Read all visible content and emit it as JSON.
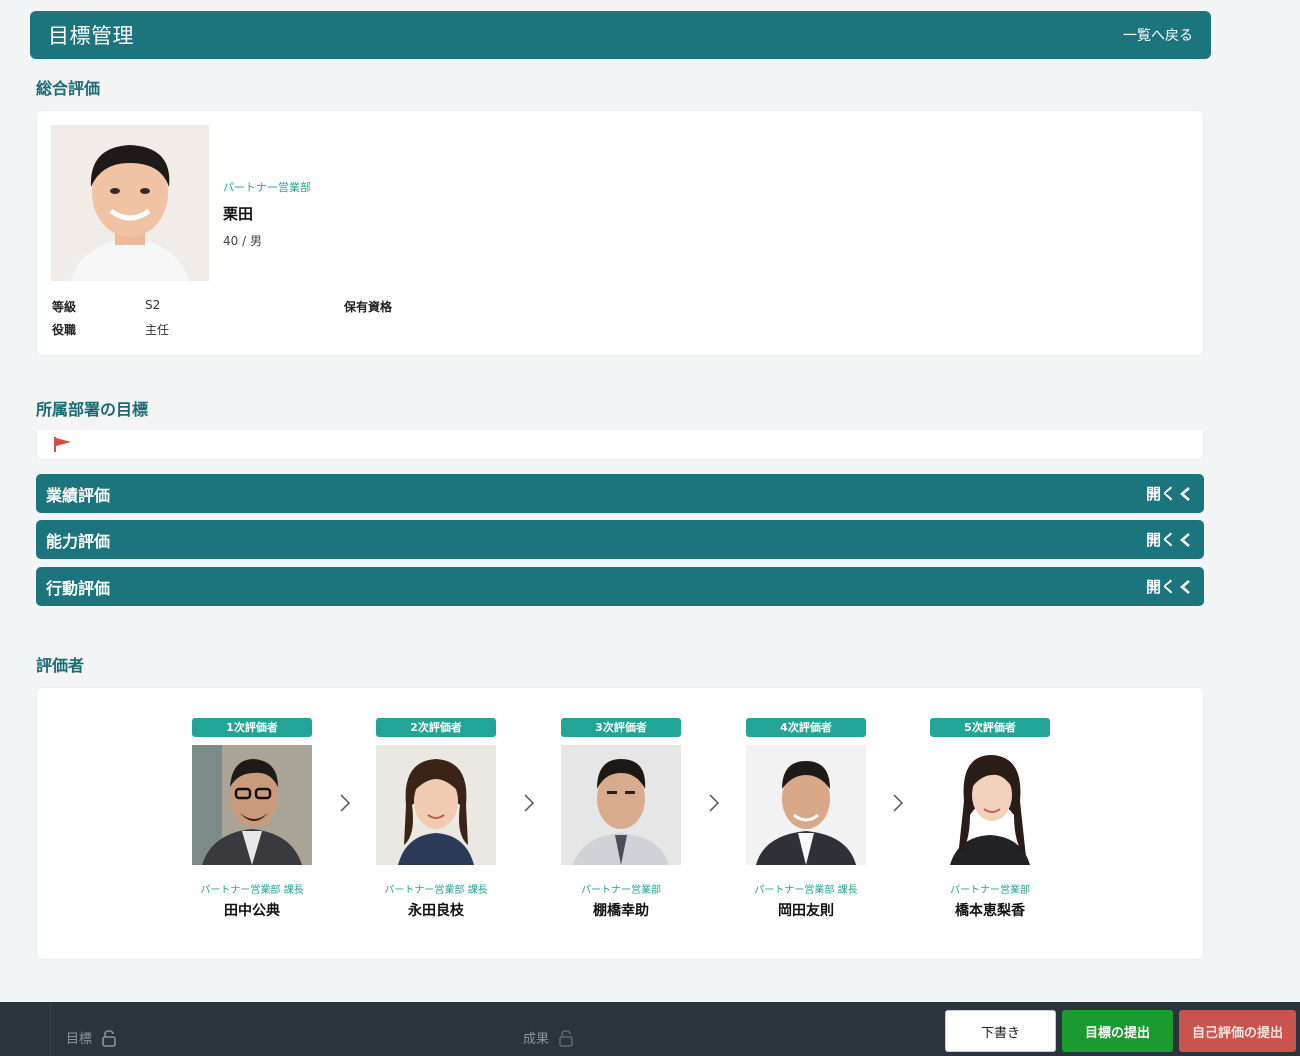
{
  "header": {
    "title": "目標管理",
    "back_label": "一覧へ戻る"
  },
  "sections": {
    "overall": "総合評価",
    "department_goals": "所属部署の目標",
    "evaluators": "評価者"
  },
  "employee": {
    "department": "パートナー営業部",
    "name": "栗田",
    "meta": "40 / 男",
    "grade_label": "等級",
    "grade_value": "S2",
    "position_label": "役職",
    "position_value": "主任",
    "qualifications_label": "保有資格"
  },
  "accordions": [
    {
      "label": "業績評価",
      "toggle": "開く"
    },
    {
      "label": "能力評価",
      "toggle": "開く"
    },
    {
      "label": "行動評価",
      "toggle": "開く"
    }
  ],
  "evaluators": [
    {
      "badge": "1次評価者",
      "dept": "パートナー営業部 課長",
      "name": "田中公典"
    },
    {
      "badge": "2次評価者",
      "dept": "パートナー営業部 課長",
      "name": "永田良枝"
    },
    {
      "badge": "3次評価者",
      "dept": "パートナー営業部",
      "name": "棚橋幸助"
    },
    {
      "badge": "4次評価者",
      "dept": "パートナー営業部 課長",
      "name": "岡田友則"
    },
    {
      "badge": "5次評価者",
      "dept": "パートナー営業部",
      "name": "橋本恵梨香"
    }
  ],
  "footer": {
    "goal_label": "目標",
    "result_label": "成果",
    "draft_button": "下書き",
    "submit_goal_button": "目標の提出",
    "submit_self_button": "自己評価の提出"
  },
  "colors": {
    "primary": "#1c747c",
    "accent": "#22a596",
    "submit": "#1a9a2f",
    "self_eval": "#c9534d"
  }
}
